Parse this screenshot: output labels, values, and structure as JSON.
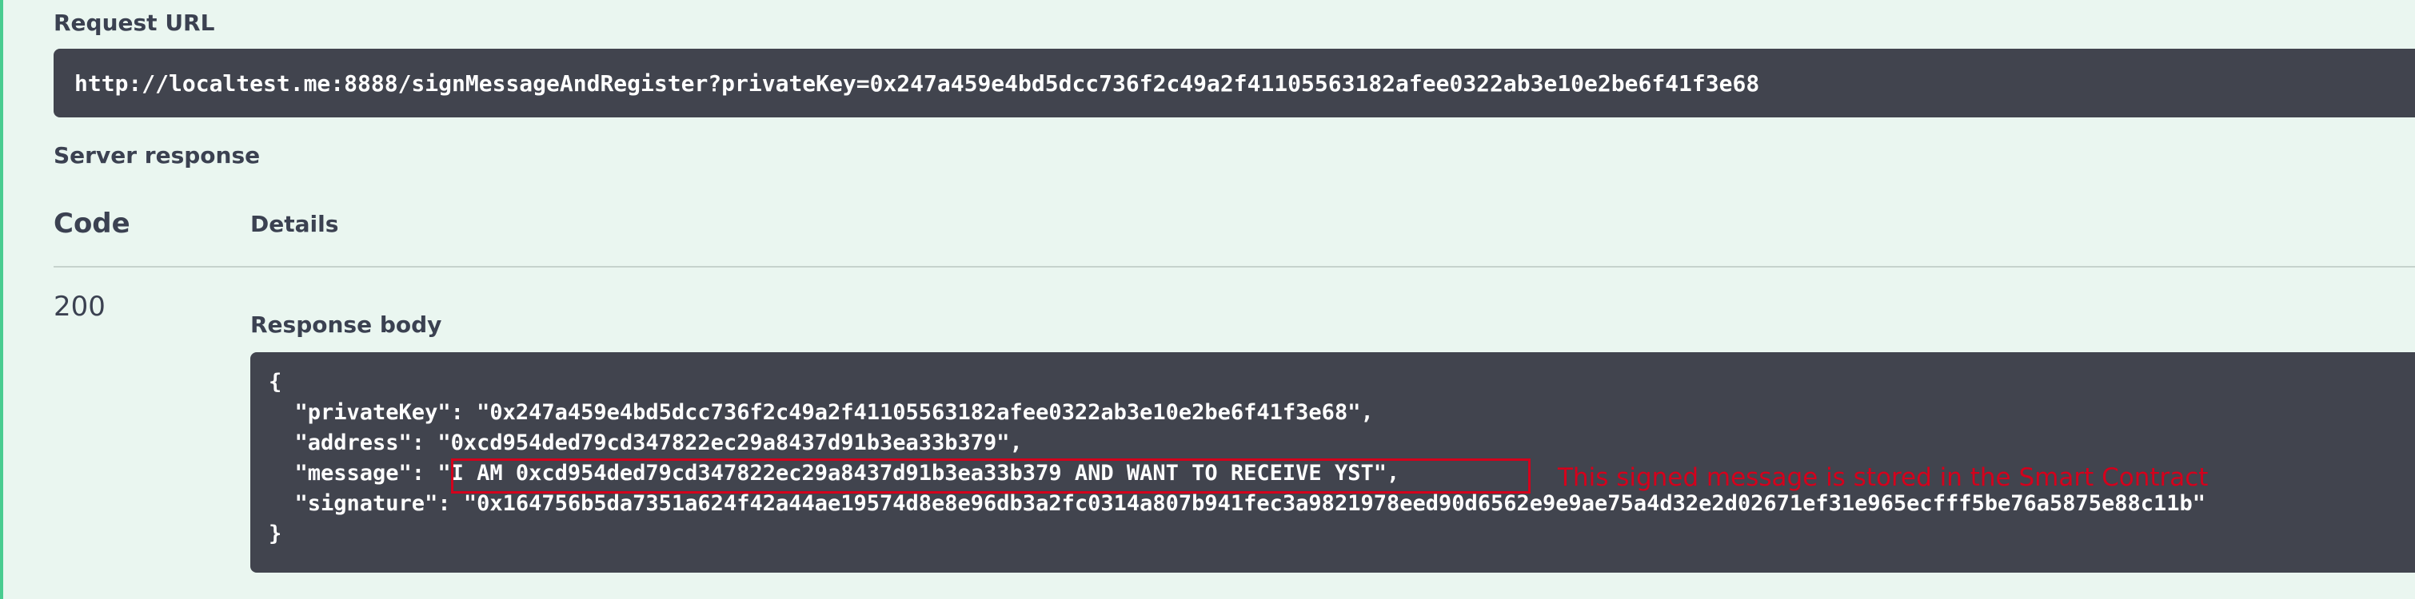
{
  "request_url": {
    "label": "Request URL",
    "value": "http://localtest.me:8888/signMessageAndRegister?privateKey=0x247a459e4bd5dcc736f2c49a2f41105563182afee0322ab3e10e2be6f41f3e68"
  },
  "server_response": {
    "label": "Server response",
    "columns": {
      "code": "Code",
      "details": "Details"
    },
    "code_value": "200",
    "response_body_label": "Response body",
    "body_lines": [
      "{",
      "  \"privateKey\": \"0x247a459e4bd5dcc736f2c49a2f41105563182afee0322ab3e10e2be6f41f3e68\",",
      "  \"address\": \"0xcd954ded79cd347822ec29a8437d91b3ea33b379\",",
      "  \"message\": \"I AM 0xcd954ded79cd347822ec29a8437d91b3ea33b379 AND WANT TO RECEIVE YST\",",
      "  \"signature\": \"0x164756b5da7351a624f42a44ae19574d8e8e96db3a2fc0314a807b941fec3a9821978eed90d6562e9e9ae75a4d32e2d02671ef31e965ecfff5be76a5875e88c11b\"",
      "}"
    ]
  },
  "annotation": {
    "text": "This signed message is stored in the Smart Contract",
    "color": "#d4001c"
  },
  "colors": {
    "background": "#eaf6f0",
    "accent_border": "#49cc90",
    "code_background": "#41444e",
    "label_text": "#3b4151"
  }
}
